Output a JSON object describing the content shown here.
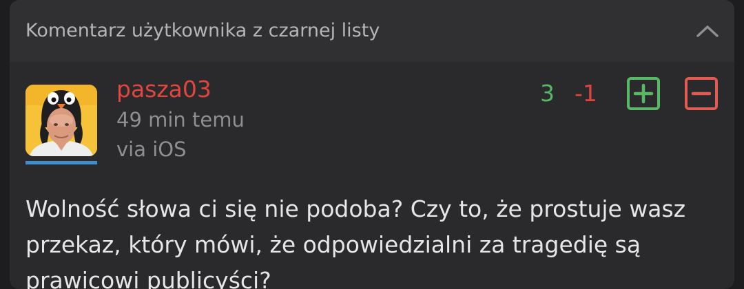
{
  "header": {
    "title": "Komentarz użytkownika z czarnej listy",
    "collapse_icon": "chevron-up-icon"
  },
  "comment": {
    "author": "pasza03",
    "time": "49 min temu",
    "via": "via iOS",
    "score_up": "3",
    "score_down": "-1",
    "text": "Wolność słowa ci się nie podoba? Czy to, że prostuje wasz przekaz, który mówi, że odpowiedzialni za tragedię są prawicowi publicyści?"
  },
  "icons": {
    "upvote": "plus-square-icon",
    "downvote": "minus-square-icon",
    "avatar": "avatar"
  },
  "colors": {
    "background": "#1d1d1f",
    "card": "#2a2a2c",
    "header": "#303032",
    "author": "#e0463f",
    "upvote": "#59b865",
    "downvote": "#e0463f",
    "avatar_underline": "#3f8fd0"
  }
}
